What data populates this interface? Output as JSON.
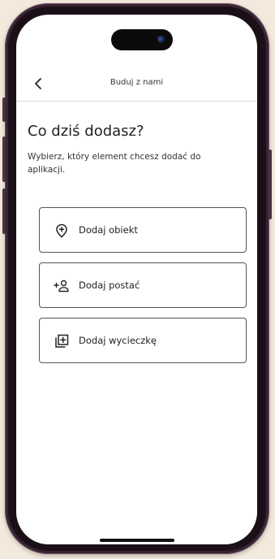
{
  "header": {
    "title": "Buduj z nami",
    "back_icon": "chevron-left-icon"
  },
  "main": {
    "heading": "Co dziś dodasz?",
    "subtitle": "Wybierz, który element chcesz dodać do aplikacji.",
    "options": [
      {
        "label": "Dodaj obiekt",
        "icon": "map-pin-plus-icon"
      },
      {
        "label": "Dodaj postać",
        "icon": "person-add-icon"
      },
      {
        "label": "Dodaj wycieczkę",
        "icon": "add-to-library-icon"
      }
    ]
  },
  "colors": {
    "background": "#f4e9dd",
    "device_frame": "#3a2434",
    "screen": "#ffffff",
    "text": "#222222",
    "border": "#555555"
  }
}
